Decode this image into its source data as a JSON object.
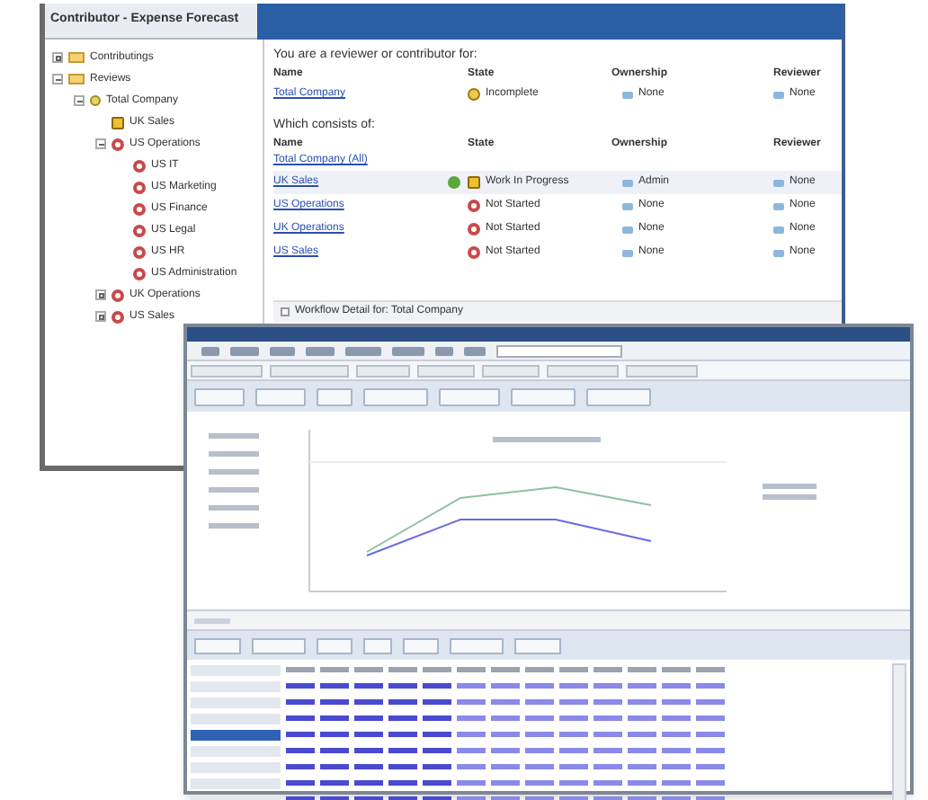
{
  "contributor_window": {
    "title": "Contributor - Expense Forecast",
    "tree": [
      {
        "label": "Contributings",
        "kind": "folder",
        "expanded": false
      },
      {
        "label": "Reviews",
        "kind": "folder",
        "expanded": true,
        "children": [
          {
            "label": "Total Company",
            "kind": "group",
            "expanded": true,
            "children": [
              {
                "label": "UK Sales",
                "kind": "in-progress"
              },
              {
                "label": "US Operations",
                "kind": "not-started",
                "expanded": true,
                "children": [
                  {
                    "label": "US IT",
                    "kind": "not-started"
                  },
                  {
                    "label": "US Marketing",
                    "kind": "not-started"
                  },
                  {
                    "label": "US Finance",
                    "kind": "not-started"
                  },
                  {
                    "label": "US Legal",
                    "kind": "not-started"
                  },
                  {
                    "label": "US HR",
                    "kind": "not-started"
                  },
                  {
                    "label": "US Administration",
                    "kind": "not-started"
                  }
                ]
              },
              {
                "label": "UK Operations",
                "kind": "not-started",
                "expanded": false
              },
              {
                "label": "US Sales",
                "kind": "not-started",
                "expanded": false
              }
            ]
          }
        ]
      }
    ],
    "reviewer_section": {
      "heading": "You are a reviewer or contributor for:",
      "columns": [
        "Name",
        "State",
        "Ownership",
        "Reviewer"
      ],
      "rows": [
        {
          "name": "Total Company",
          "state": "Incomplete",
          "kind": "incomplete",
          "ownership": "None",
          "reviewer": "None"
        }
      ]
    },
    "consists_section": {
      "heading": "Which consists of:",
      "columns": [
        "Name",
        "State",
        "Ownership",
        "Reviewer"
      ],
      "total_link": "Total Company (All)",
      "rows": [
        {
          "name": "UK Sales",
          "state": "Work In Progress",
          "kind": "in-progress",
          "ownership": "Admin",
          "reviewer": "None",
          "selected": true
        },
        {
          "name": "US Operations",
          "state": "Not Started",
          "kind": "not-started",
          "ownership": "None",
          "reviewer": "None",
          "selected": false
        },
        {
          "name": "UK Operations",
          "state": "Not Started",
          "kind": "not-started",
          "ownership": "None",
          "reviewer": "None",
          "selected": false
        },
        {
          "name": "US Sales",
          "state": "Not Started",
          "kind": "not-started",
          "ownership": "None",
          "reviewer": "None",
          "selected": false
        }
      ]
    },
    "workflow_detail": "Workflow Detail for: Total Company"
  }
}
